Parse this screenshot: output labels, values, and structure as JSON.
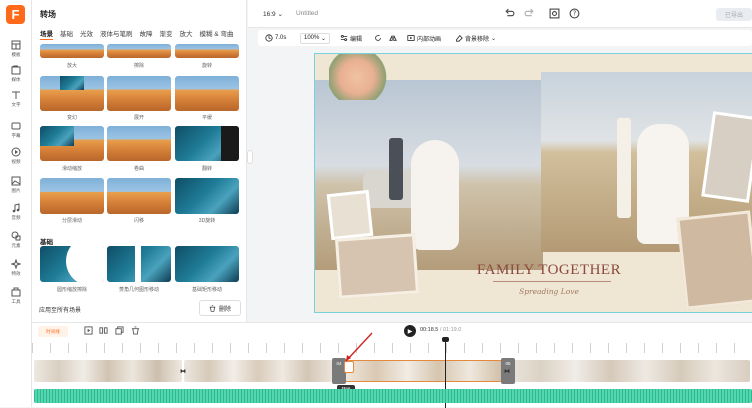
{
  "app": {
    "logo_letter": "F",
    "brand_color": "#ff6a1a"
  },
  "rail": [
    {
      "label": "模板",
      "icon": "template-icon"
    },
    {
      "label": "媒体",
      "icon": "media-icon"
    },
    {
      "label": "文字",
      "icon": "text-icon"
    },
    {
      "label": "字幕",
      "icon": "subtitle-icon"
    },
    {
      "label": "视频",
      "icon": "video-icon"
    },
    {
      "label": "图片",
      "icon": "image-icon"
    },
    {
      "label": "音频",
      "icon": "audio-icon"
    },
    {
      "label": "元素",
      "icon": "element-icon"
    },
    {
      "label": "特效",
      "icon": "effect-icon"
    },
    {
      "label": "工具",
      "icon": "tools-icon"
    }
  ],
  "panel": {
    "title": "转场",
    "tabs": [
      "场景",
      "基础",
      "光效",
      "液体与笔刷",
      "故障",
      "渐变",
      "放大",
      "模糊 & 弯曲"
    ],
    "active_tab": "场景",
    "thumbs_row0": [
      "放大",
      "擦除",
      "旋转"
    ],
    "thumbs_row1": [
      "变幻",
      "展开",
      "平缓"
    ],
    "thumbs_row2": [
      "滑动缩放",
      "卷曲",
      "翻转"
    ],
    "thumbs_row3": [
      "分层滑动",
      "闪移",
      "3D旋转"
    ],
    "section_basic": "基础",
    "basic_thumbs": [
      "圆形缩放擦除",
      "菱角几何图形移动",
      "基础矩形移动"
    ],
    "apply_all": "应用至所有场景",
    "delete": "删除"
  },
  "topbar": {
    "ratio": "16:9",
    "title": "Untitled",
    "export": "已导出"
  },
  "toolbar": {
    "duration": "7.0s",
    "zoom": "100%",
    "edit": "编辑",
    "animation": "内部动画",
    "bg_remove": "背景移除"
  },
  "canvas": {
    "title": "FAMILY TOGETHER",
    "subtitle": "Spreading Love"
  },
  "timeline": {
    "track_btn": "时间线",
    "current": "00:18.5",
    "total": "/ 01:19.0",
    "clip_num_a": "04",
    "clip_num_b": "05",
    "marker": "转场"
  }
}
